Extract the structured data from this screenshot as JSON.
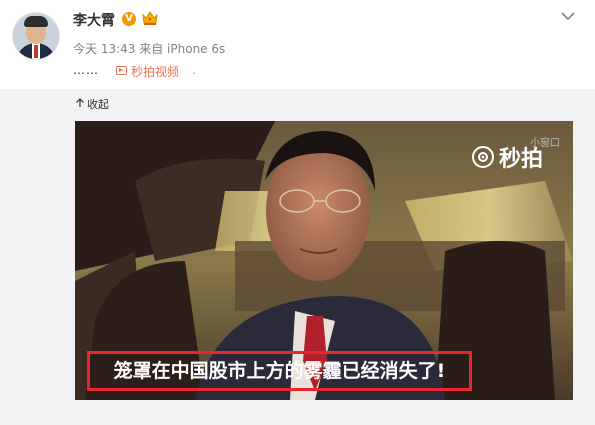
{
  "post": {
    "author": "李大霄",
    "verified_badge": "V",
    "time": "今天 13:43",
    "source": "来自 iPhone 6s",
    "text_dots": "……",
    "miaopai_link": "秒拍视频",
    "link_tail": "."
  },
  "media": {
    "collapse_label": "收起",
    "mini_window_label": "小窗口",
    "logo_text": "秒拍",
    "subtitle": "笼罩在中国股市上方的雾霾已经消失了!"
  },
  "icons": [
    "avatar",
    "verified-icon",
    "crown-icon",
    "chevron-down-icon",
    "video-icon",
    "collapse-arrow-icon",
    "miaopai-logo-icon"
  ],
  "colors": {
    "link": "#eb7350",
    "subtitle_border": "#e8262d",
    "panel_bg": "#f2f2f5",
    "verified": "#f39800"
  }
}
